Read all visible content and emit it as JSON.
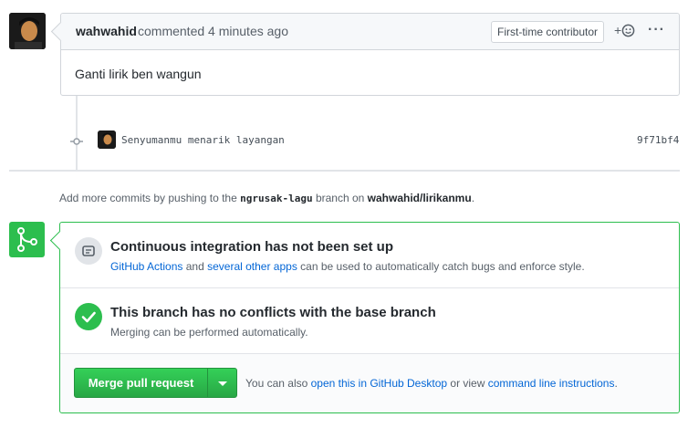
{
  "comment": {
    "author": "wahwahid",
    "meta": "commented 4 minutes ago",
    "badge": "First-time contributor",
    "reaction": "+",
    "menu": "···",
    "body": "Ganti lirik ben wangun"
  },
  "commit": {
    "message": "Senyumanmu menarik layangan",
    "sha": "9f71bf4"
  },
  "hint": {
    "prefix": "Add more commits by pushing to the",
    "branch": "ngrusak-lagu",
    "middle": "branch on",
    "repo": "wahwahid/lirikanmu",
    "suffix": "."
  },
  "merge": {
    "ci_title": "Continuous integration has not been set up",
    "ci_link1": "GitHub Actions",
    "ci_and": "and",
    "ci_link2": "several other apps",
    "ci_rest": "can be used to automatically catch bugs and enforce style.",
    "conflict_title": "This branch has no conflicts with the base branch",
    "conflict_text": "Merging can be performed automatically.",
    "button": "Merge pull request",
    "note_prefix": "You can also",
    "note_link1": "open this in GitHub Desktop",
    "note_mid": "or view",
    "note_link2": "command line instructions",
    "note_suffix": "."
  },
  "colors": {
    "green": "#2cbe4e",
    "link": "#0366d6",
    "border": "#d1d5da"
  }
}
